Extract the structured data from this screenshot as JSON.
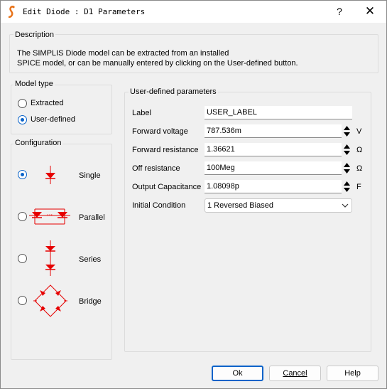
{
  "window": {
    "title": "Edit Diode : D1 Parameters",
    "help": "?",
    "close": "✕"
  },
  "description": {
    "label": "Description",
    "line1": "The SIMPLIS Diode model can be extracted from an installed",
    "line2": "SPICE model, or can be manually entered by clicking on the User-defined button."
  },
  "model_type": {
    "label": "Model type",
    "options": [
      "Extracted",
      "User-defined"
    ],
    "selected": "User-defined"
  },
  "configuration": {
    "label": "Configuration",
    "options": [
      "Single",
      "Parallel",
      "Series",
      "Bridge"
    ],
    "selected": "Single"
  },
  "params": {
    "label": "User-defined parameters",
    "rows": [
      {
        "label": "Label",
        "value": "USER_LABEL",
        "unit": ""
      },
      {
        "label": "Forward voltage",
        "value": "787.536m",
        "unit": "V"
      },
      {
        "label": "Forward resistance",
        "value": "1.36621",
        "unit": "Ω"
      },
      {
        "label": "Off resistance",
        "value": "100Meg",
        "unit": "Ω"
      },
      {
        "label": "Output Capacitance",
        "value": "1.08098p",
        "unit": "F"
      }
    ],
    "initial_condition": {
      "label": "Initial Condition",
      "value": "1 Reversed Biased"
    }
  },
  "buttons": {
    "ok": "Ok",
    "cancel": "Cancel",
    "help": "Help"
  },
  "colors": {
    "accent": "#0a63c9",
    "diode": "#e60000"
  }
}
